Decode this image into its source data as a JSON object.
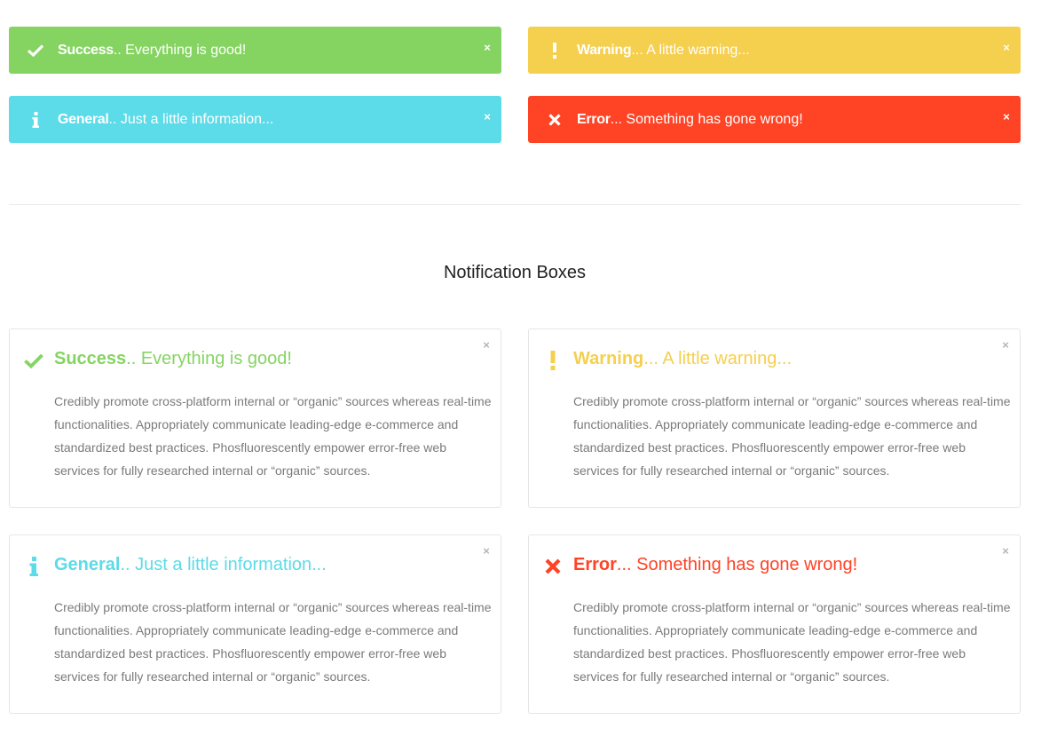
{
  "colors": {
    "success": "#85d462",
    "warning": "#f5cf4e",
    "general": "#5cdbe8",
    "error": "#ff4325"
  },
  "alerts": {
    "success": {
      "icon": "check-icon",
      "title": "Success",
      "message": ".. Everything is good!",
      "close": "×"
    },
    "warning": {
      "icon": "exclamation-icon",
      "title": "Warning",
      "message": "... A little warning...",
      "close": "×"
    },
    "general": {
      "icon": "info-icon",
      "title": "General",
      "message": ".. Just a little information...",
      "close": "×"
    },
    "error": {
      "icon": "x-icon",
      "title": "Error",
      "message": "... Something has gone wrong!",
      "close": "×"
    }
  },
  "section_title": "Notification Boxes",
  "boxes": {
    "success": {
      "icon": "check-icon",
      "title": "Success",
      "message": ".. Everything is good!",
      "close": "×",
      "body": "Credibly promote cross-platform internal or “organic” sources whereas real-time functionalities. Appropriately communicate leading-edge e-commerce and standardized best practices. Phosfluorescently empower error-free web services for fully researched internal or “organic” sources."
    },
    "warning": {
      "icon": "exclamation-icon",
      "title": "Warning",
      "message": "... A little warning...",
      "close": "×",
      "body": "Credibly promote cross-platform internal or “organic” sources whereas real-time functionalities. Appropriately communicate leading-edge e-commerce and standardized best practices. Phosfluorescently empower error-free web services for fully researched internal or “organic” sources."
    },
    "general": {
      "icon": "info-icon",
      "title": "General",
      "message": ".. Just a little information...",
      "close": "×",
      "body": "Credibly promote cross-platform internal or “organic” sources whereas real-time functionalities. Appropriately communicate leading-edge e-commerce and standardized best practices. Phosfluorescently empower error-free web services for fully researched internal or “organic” sources."
    },
    "error": {
      "icon": "x-icon",
      "title": "Error",
      "message": "... Something has gone wrong!",
      "close": "×",
      "body": "Credibly promote cross-platform internal or “organic” sources whereas real-time functionalities. Appropriately communicate leading-edge e-commerce and standardized best practices. Phosfluorescently empower error-free web services for fully researched internal or “organic” sources."
    }
  }
}
